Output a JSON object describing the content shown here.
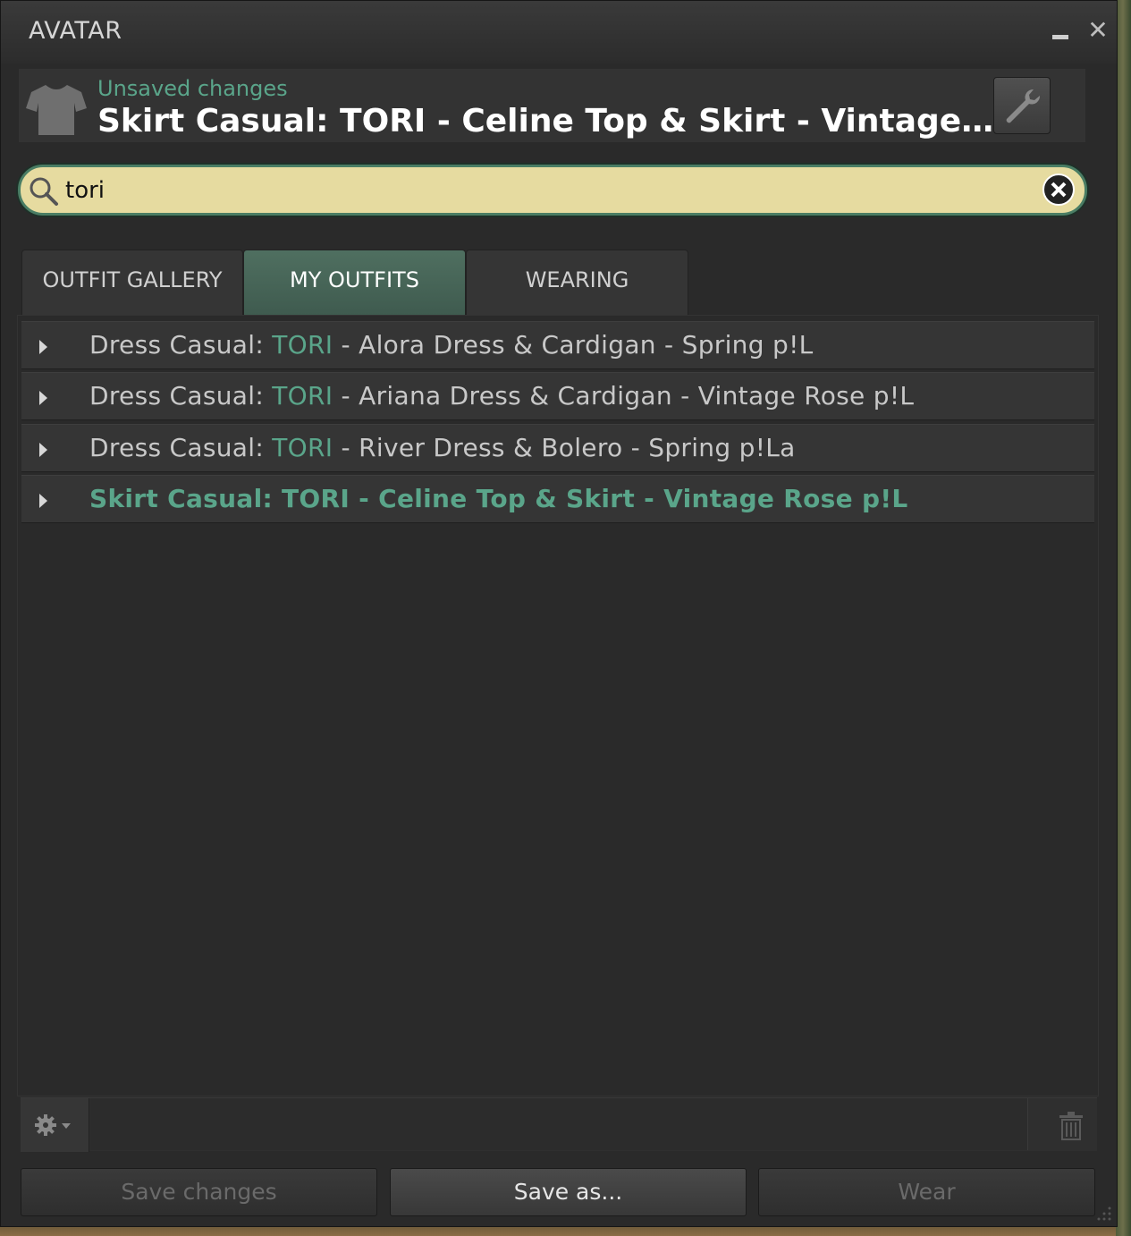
{
  "window": {
    "title": "AVATAR",
    "minimize_label": "",
    "close_label": "✕"
  },
  "header": {
    "status": "Unsaved changes",
    "outfit_name": "Skirt Casual: TORI - Celine Top & Skirt - Vintage Rose p!L",
    "icon": "shirt-icon"
  },
  "search": {
    "value": "tori",
    "placeholder": ""
  },
  "tabs": [
    {
      "label": "OUTFIT GALLERY",
      "active": false
    },
    {
      "label": "MY OUTFITS",
      "active": true
    },
    {
      "label": "WEARING",
      "active": false
    }
  ],
  "outfits": [
    {
      "prefix": "Dress Casual: ",
      "match": "TORI",
      "suffix": " - Alora Dress & Cardigan - Spring p!L",
      "selected": false
    },
    {
      "prefix": "Dress Casual: ",
      "match": "TORI",
      "suffix": " - Ariana Dress & Cardigan - Vintage Rose p!L",
      "selected": false
    },
    {
      "prefix": "Dress Casual: ",
      "match": "TORI",
      "suffix": " - River Dress & Bolero - Spring p!La",
      "selected": false
    },
    {
      "prefix": "Skirt Casual: ",
      "match": "TORI",
      "suffix": " - Celine Top & Skirt - Vintage Rose p!L",
      "selected": true
    }
  ],
  "actions": {
    "save_changes": "Save changes",
    "save_as": "Save as...",
    "wear": "Wear"
  },
  "colors": {
    "accent": "#5aa58a",
    "search_bg": "#e6dba0",
    "panel_bg": "#2a2a2a"
  }
}
